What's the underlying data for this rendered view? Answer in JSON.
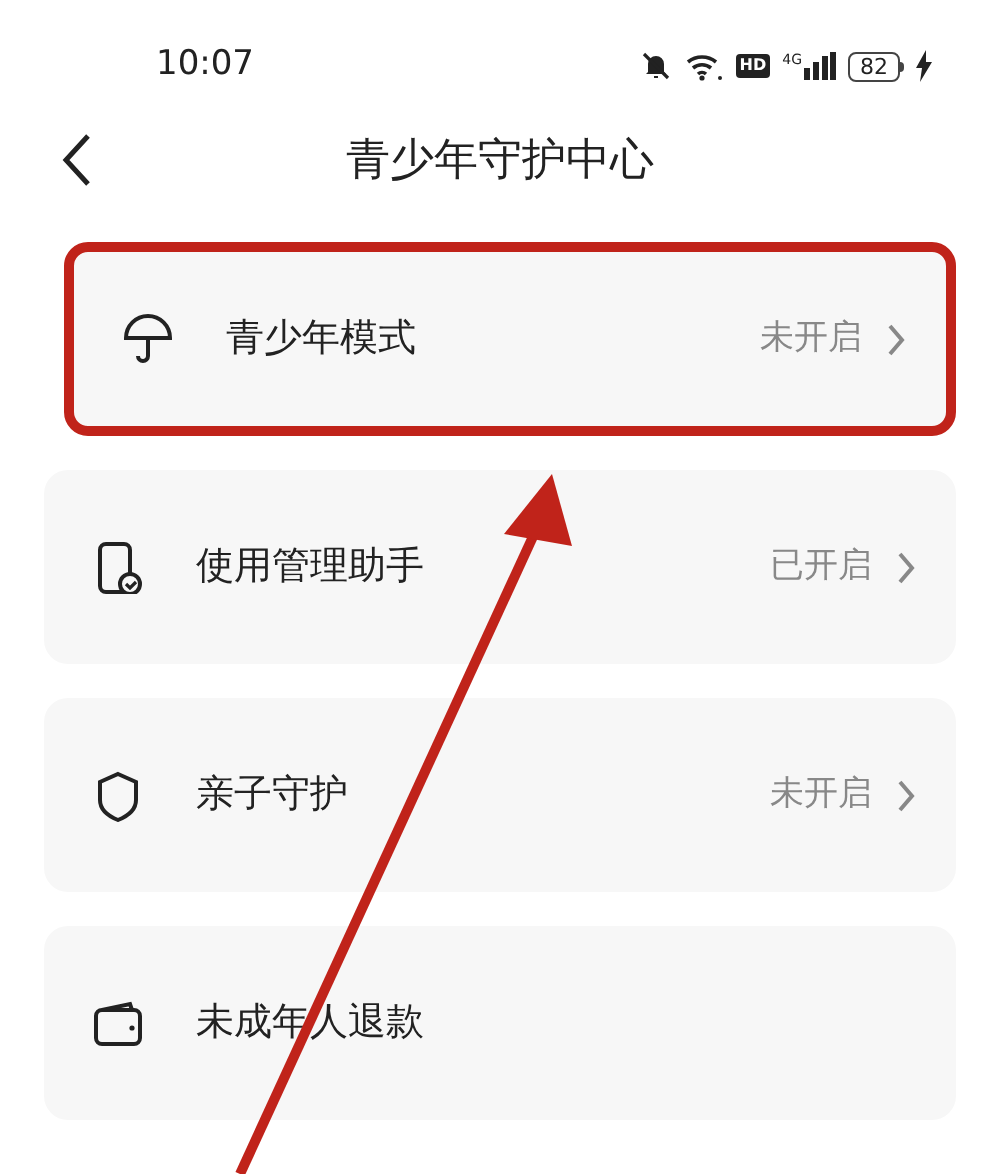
{
  "status_bar": {
    "time": "10:07",
    "hd_label": "HD",
    "network_label": "4G",
    "battery": "82"
  },
  "header": {
    "title": "青少年守护中心"
  },
  "rows": [
    {
      "kind": "umbrella",
      "label": "青少年模式",
      "status": "未开启",
      "highlighted": true
    },
    {
      "kind": "phone",
      "label": "使用管理助手",
      "status": "已开启",
      "highlighted": false
    },
    {
      "kind": "shield",
      "label": "亲子守护",
      "status": "未开启",
      "highlighted": false
    },
    {
      "kind": "wallet",
      "label": "未成年人退款",
      "highlighted": false
    }
  ]
}
